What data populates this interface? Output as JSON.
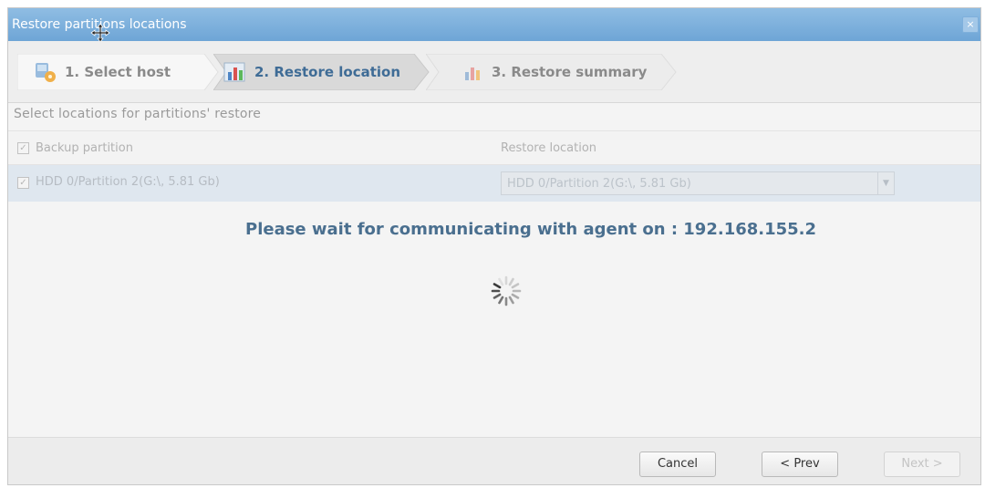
{
  "window": {
    "title": "Restore partitions locations",
    "close_glyph": "×"
  },
  "steps": [
    {
      "label": "1. Select host",
      "icon": "host-icon",
      "state": "completed"
    },
    {
      "label": "2. Restore location",
      "icon": "chart-icon",
      "state": "active"
    },
    {
      "label": "3. Restore summary",
      "icon": "chart-icon",
      "state": "pending"
    }
  ],
  "section": {
    "title": "Select locations for partitions' restore"
  },
  "table": {
    "headers": {
      "backup": "Backup partition",
      "restore": "Restore location"
    },
    "rows": [
      {
        "checked": true,
        "backup_partition": "HDD 0/Partition 2(G:\\, 5.81 Gb)",
        "restore_location": "HDD 0/Partition 2(G:\\, 5.81 Gb)"
      }
    ],
    "check_glyph": "✓",
    "dropdown_glyph": "▼"
  },
  "status": {
    "message": "Please wait for communicating with agent on : 192.168.155.2"
  },
  "buttons": {
    "cancel": "Cancel",
    "prev": "< Prev",
    "next": "Next >"
  },
  "colors": {
    "titlebar": "#7ab0dc",
    "status_text": "#4a6f8f",
    "active_step_bg": "#d9d9d9",
    "selected_row": "#dfe7ef"
  }
}
